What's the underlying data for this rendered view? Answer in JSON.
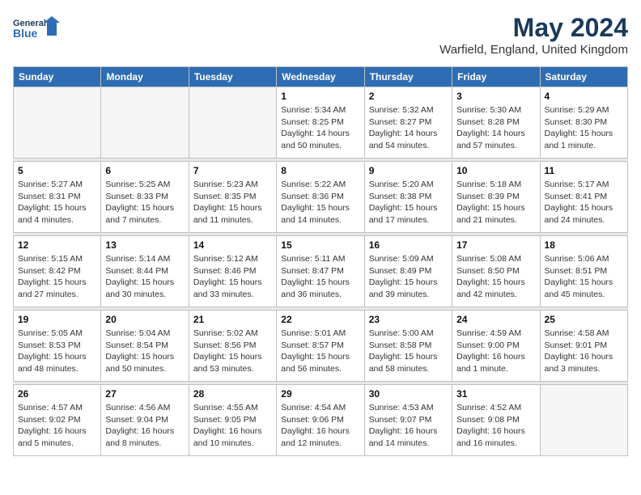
{
  "logo": {
    "line1": "General",
    "line2": "Blue"
  },
  "title": "May 2024",
  "location": "Warfield, England, United Kingdom",
  "weekdays": [
    "Sunday",
    "Monday",
    "Tuesday",
    "Wednesday",
    "Thursday",
    "Friday",
    "Saturday"
  ],
  "weeks": [
    [
      {
        "day": "",
        "info": ""
      },
      {
        "day": "",
        "info": ""
      },
      {
        "day": "",
        "info": ""
      },
      {
        "day": "1",
        "info": "Sunrise: 5:34 AM\nSunset: 8:25 PM\nDaylight: 14 hours\nand 50 minutes."
      },
      {
        "day": "2",
        "info": "Sunrise: 5:32 AM\nSunset: 8:27 PM\nDaylight: 14 hours\nand 54 minutes."
      },
      {
        "day": "3",
        "info": "Sunrise: 5:30 AM\nSunset: 8:28 PM\nDaylight: 14 hours\nand 57 minutes."
      },
      {
        "day": "4",
        "info": "Sunrise: 5:29 AM\nSunset: 8:30 PM\nDaylight: 15 hours\nand 1 minute."
      }
    ],
    [
      {
        "day": "5",
        "info": "Sunrise: 5:27 AM\nSunset: 8:31 PM\nDaylight: 15 hours\nand 4 minutes."
      },
      {
        "day": "6",
        "info": "Sunrise: 5:25 AM\nSunset: 8:33 PM\nDaylight: 15 hours\nand 7 minutes."
      },
      {
        "day": "7",
        "info": "Sunrise: 5:23 AM\nSunset: 8:35 PM\nDaylight: 15 hours\nand 11 minutes."
      },
      {
        "day": "8",
        "info": "Sunrise: 5:22 AM\nSunset: 8:36 PM\nDaylight: 15 hours\nand 14 minutes."
      },
      {
        "day": "9",
        "info": "Sunrise: 5:20 AM\nSunset: 8:38 PM\nDaylight: 15 hours\nand 17 minutes."
      },
      {
        "day": "10",
        "info": "Sunrise: 5:18 AM\nSunset: 8:39 PM\nDaylight: 15 hours\nand 21 minutes."
      },
      {
        "day": "11",
        "info": "Sunrise: 5:17 AM\nSunset: 8:41 PM\nDaylight: 15 hours\nand 24 minutes."
      }
    ],
    [
      {
        "day": "12",
        "info": "Sunrise: 5:15 AM\nSunset: 8:42 PM\nDaylight: 15 hours\nand 27 minutes."
      },
      {
        "day": "13",
        "info": "Sunrise: 5:14 AM\nSunset: 8:44 PM\nDaylight: 15 hours\nand 30 minutes."
      },
      {
        "day": "14",
        "info": "Sunrise: 5:12 AM\nSunset: 8:46 PM\nDaylight: 15 hours\nand 33 minutes."
      },
      {
        "day": "15",
        "info": "Sunrise: 5:11 AM\nSunset: 8:47 PM\nDaylight: 15 hours\nand 36 minutes."
      },
      {
        "day": "16",
        "info": "Sunrise: 5:09 AM\nSunset: 8:49 PM\nDaylight: 15 hours\nand 39 minutes."
      },
      {
        "day": "17",
        "info": "Sunrise: 5:08 AM\nSunset: 8:50 PM\nDaylight: 15 hours\nand 42 minutes."
      },
      {
        "day": "18",
        "info": "Sunrise: 5:06 AM\nSunset: 8:51 PM\nDaylight: 15 hours\nand 45 minutes."
      }
    ],
    [
      {
        "day": "19",
        "info": "Sunrise: 5:05 AM\nSunset: 8:53 PM\nDaylight: 15 hours\nand 48 minutes."
      },
      {
        "day": "20",
        "info": "Sunrise: 5:04 AM\nSunset: 8:54 PM\nDaylight: 15 hours\nand 50 minutes."
      },
      {
        "day": "21",
        "info": "Sunrise: 5:02 AM\nSunset: 8:56 PM\nDaylight: 15 hours\nand 53 minutes."
      },
      {
        "day": "22",
        "info": "Sunrise: 5:01 AM\nSunset: 8:57 PM\nDaylight: 15 hours\nand 56 minutes."
      },
      {
        "day": "23",
        "info": "Sunrise: 5:00 AM\nSunset: 8:58 PM\nDaylight: 15 hours\nand 58 minutes."
      },
      {
        "day": "24",
        "info": "Sunrise: 4:59 AM\nSunset: 9:00 PM\nDaylight: 16 hours\nand 1 minute."
      },
      {
        "day": "25",
        "info": "Sunrise: 4:58 AM\nSunset: 9:01 PM\nDaylight: 16 hours\nand 3 minutes."
      }
    ],
    [
      {
        "day": "26",
        "info": "Sunrise: 4:57 AM\nSunset: 9:02 PM\nDaylight: 16 hours\nand 5 minutes."
      },
      {
        "day": "27",
        "info": "Sunrise: 4:56 AM\nSunset: 9:04 PM\nDaylight: 16 hours\nand 8 minutes."
      },
      {
        "day": "28",
        "info": "Sunrise: 4:55 AM\nSunset: 9:05 PM\nDaylight: 16 hours\nand 10 minutes."
      },
      {
        "day": "29",
        "info": "Sunrise: 4:54 AM\nSunset: 9:06 PM\nDaylight: 16 hours\nand 12 minutes."
      },
      {
        "day": "30",
        "info": "Sunrise: 4:53 AM\nSunset: 9:07 PM\nDaylight: 16 hours\nand 14 minutes."
      },
      {
        "day": "31",
        "info": "Sunrise: 4:52 AM\nSunset: 9:08 PM\nDaylight: 16 hours\nand 16 minutes."
      },
      {
        "day": "",
        "info": ""
      }
    ]
  ]
}
